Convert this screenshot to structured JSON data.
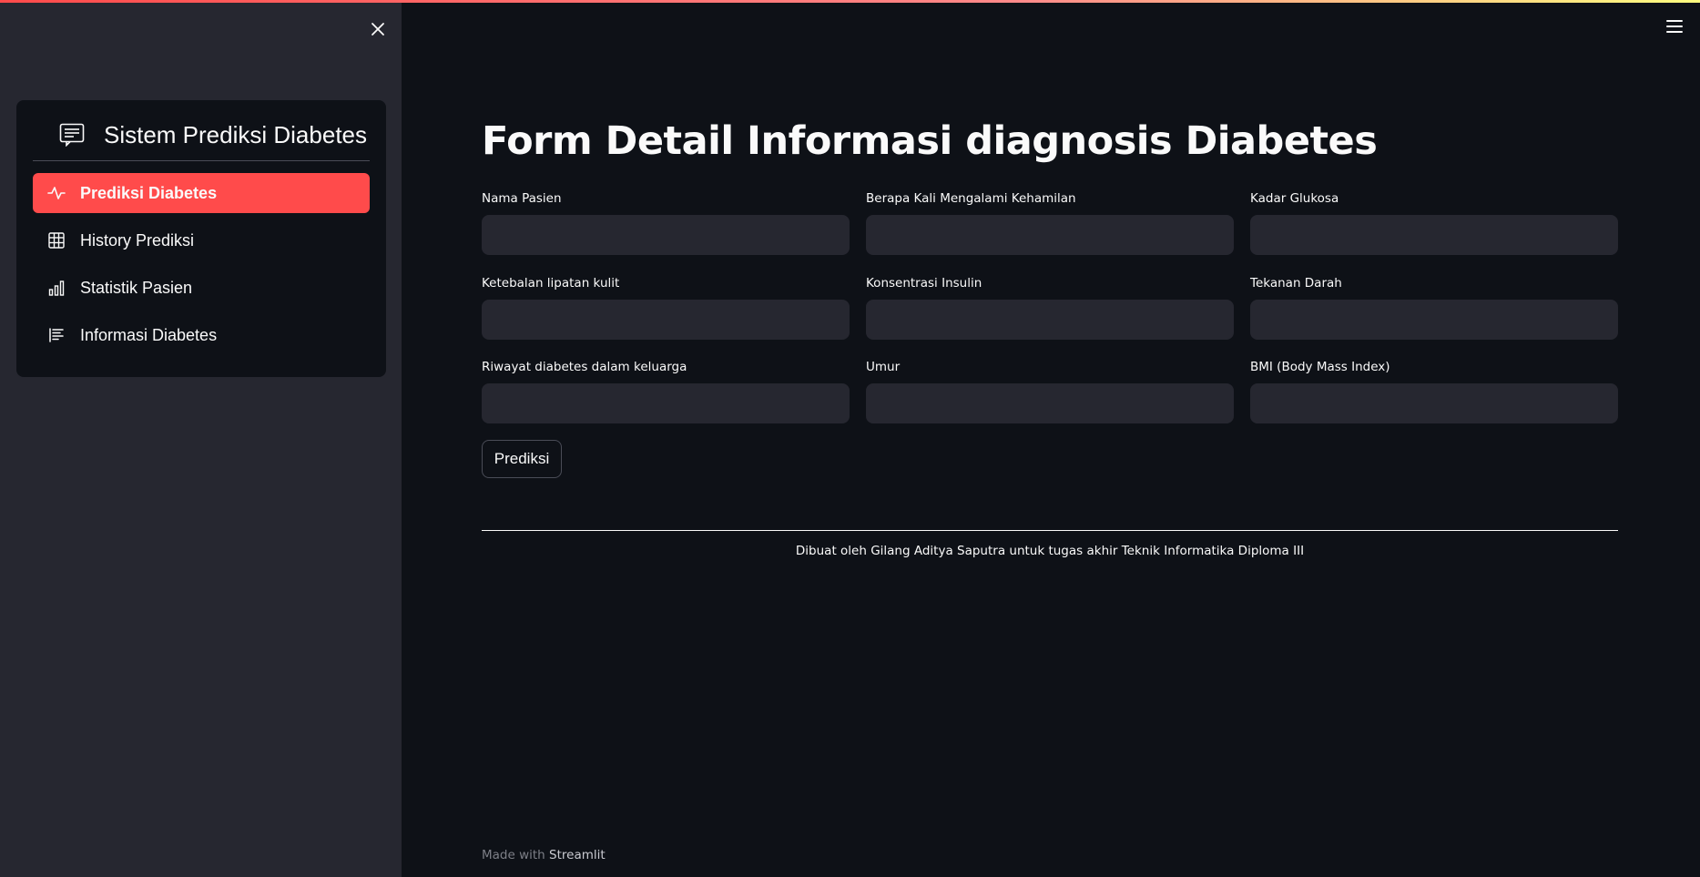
{
  "sidebar": {
    "close_icon": "close-icon",
    "menu": {
      "title": "Sistem Prediksi Diabetes",
      "title_icon": "form-list-icon",
      "items": [
        {
          "label": "Prediksi Diabetes",
          "icon": "activity-icon",
          "active": true
        },
        {
          "label": "History Prediksi",
          "icon": "table-icon",
          "active": false
        },
        {
          "label": "Statistik Pasien",
          "icon": "bar-chart-icon",
          "active": false
        },
        {
          "label": "Informasi Diabetes",
          "icon": "text-paragraph-icon",
          "active": false
        }
      ],
      "accent_color": "#ff4b4b"
    }
  },
  "header": {
    "menu_icon": "hamburger-menu-icon"
  },
  "main": {
    "title": "Form Detail Informasi diagnosis Diabetes",
    "fields": [
      {
        "label": "Nama Pasien",
        "value": "",
        "placeholder": ""
      },
      {
        "label": "Berapa Kali Mengalami Kehamilan",
        "value": "",
        "placeholder": ""
      },
      {
        "label": "Kadar Glukosa",
        "value": "",
        "placeholder": ""
      },
      {
        "label": "Ketebalan lipatan kulit",
        "value": "",
        "placeholder": ""
      },
      {
        "label": "Konsentrasi Insulin",
        "value": "",
        "placeholder": ""
      },
      {
        "label": "Tekanan Darah",
        "value": "",
        "placeholder": ""
      },
      {
        "label": "Riwayat diabetes dalam keluarga",
        "value": "",
        "placeholder": ""
      },
      {
        "label": "Umur",
        "value": "",
        "placeholder": ""
      },
      {
        "label": "BMI (Body Mass Index)",
        "value": "",
        "placeholder": ""
      }
    ],
    "submit_label": "Prediksi",
    "credit": "Dibuat oleh Gilang Aditya Saputra untuk tugas akhir Teknik Informatika Diploma III"
  },
  "footer": {
    "made_with": "Made with",
    "brand": "Streamlit"
  },
  "colors": {
    "background": "#0e1117",
    "sidebar": "#262730",
    "input": "#262730",
    "accent": "#ff4b4b"
  }
}
